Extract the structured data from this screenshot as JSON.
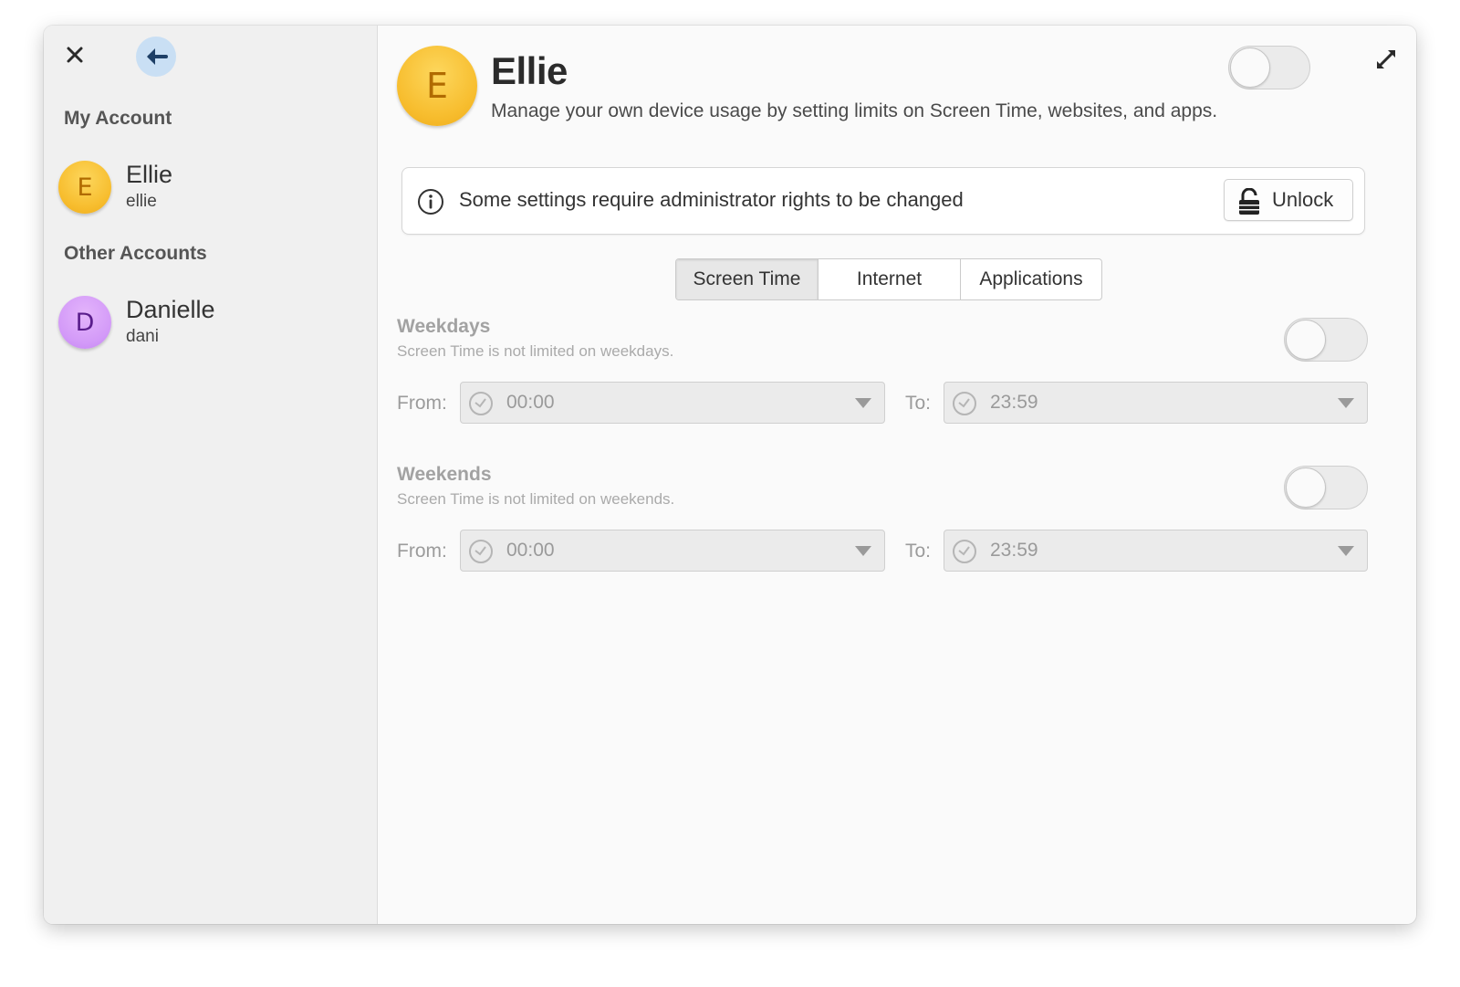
{
  "sidebar": {
    "close_icon": "close-icon",
    "back_icon": "back-arrow-icon",
    "my_account_header": "My Account",
    "other_accounts_header": "Other Accounts",
    "my_account": {
      "initial": "E",
      "name": "Ellie",
      "username": "ellie",
      "color": "#f7bd2e"
    },
    "other_accounts": [
      {
        "initial": "D",
        "name": "Danielle",
        "username": "dani",
        "color": "#d39af8"
      }
    ]
  },
  "header": {
    "avatar_initial": "E",
    "name": "Ellie",
    "subtitle": "Manage your own device usage by setting limits on Screen Time, websites, and apps.",
    "enable_switch_on": false,
    "expand_icon": "expand-icon"
  },
  "info_bar": {
    "icon": "info-icon",
    "text": "Some settings require administrator rights to be changed",
    "unlock_label": "Unlock",
    "unlock_icon": "lock-icon"
  },
  "tabs": [
    {
      "label": "Screen Time",
      "active": true
    },
    {
      "label": "Internet",
      "active": false
    },
    {
      "label": "Applications",
      "active": false
    }
  ],
  "schedule": {
    "weekdays": {
      "title": "Weekdays",
      "description": "Screen Time is not limited on weekdays.",
      "enabled": false,
      "from_label": "From:",
      "from_value": "00:00",
      "to_label": "To:",
      "to_value": "23:59"
    },
    "weekends": {
      "title": "Weekends",
      "description": "Screen Time is not limited on weekends.",
      "enabled": false,
      "from_label": "From:",
      "from_value": "00:00",
      "to_label": "To:",
      "to_value": "23:59"
    }
  }
}
